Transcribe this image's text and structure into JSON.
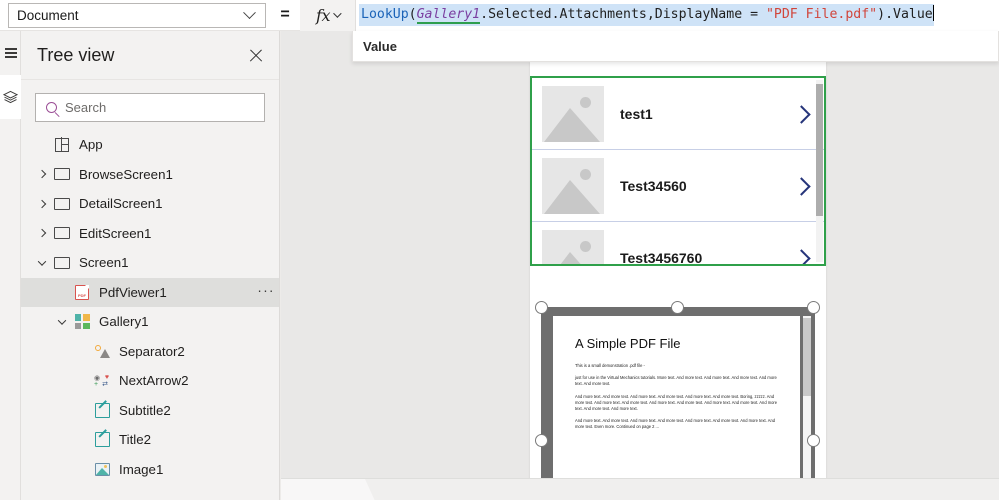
{
  "topbar": {
    "property_selector": {
      "value": "Document",
      "icon": "chevron-down-icon"
    },
    "equals_sign": "=",
    "fx_label": "fx",
    "formula": {
      "tokens": [
        {
          "text": "LookUp",
          "kind": "fn"
        },
        {
          "text": "(",
          "kind": "op"
        },
        {
          "text": "Gallery1",
          "kind": "ctrl"
        },
        {
          "text": ".Selected.Attachments,DisplayName",
          "kind": "plain"
        },
        {
          "text": " = ",
          "kind": "op"
        },
        {
          "text": "\"PDF File.pdf\"",
          "kind": "str"
        },
        {
          "text": ").Value",
          "kind": "plain"
        }
      ],
      "plain_text": "LookUp(Gallery1.Selected.Attachments,DisplayName = \"PDF File.pdf\").Value"
    },
    "intellisense": {
      "suggestion": "Value"
    }
  },
  "rail": {
    "items": [
      {
        "name": "menu",
        "icon": "hamburger-icon",
        "active": false
      },
      {
        "name": "tree-view",
        "icon": "layers-icon",
        "active": true
      }
    ]
  },
  "tree_panel": {
    "title": "Tree view",
    "close_label": "×",
    "search": {
      "placeholder": "Search",
      "value": "",
      "icon": "search-icon"
    },
    "items": [
      {
        "label": "App",
        "icon": "app-icon",
        "indent": 0,
        "chevron": "none",
        "selected": false
      },
      {
        "label": "BrowseScreen1",
        "icon": "screen-icon",
        "indent": 0,
        "chevron": "collapsed",
        "selected": false
      },
      {
        "label": "DetailScreen1",
        "icon": "screen-icon",
        "indent": 0,
        "chevron": "collapsed",
        "selected": false
      },
      {
        "label": "EditScreen1",
        "icon": "screen-icon",
        "indent": 0,
        "chevron": "collapsed",
        "selected": false
      },
      {
        "label": "Screen1",
        "icon": "screen-icon",
        "indent": 0,
        "chevron": "expanded",
        "selected": false
      },
      {
        "label": "PdfViewer1",
        "icon": "pdf-icon",
        "indent": 1,
        "chevron": "none",
        "selected": true,
        "menu": "···"
      },
      {
        "label": "Gallery1",
        "icon": "gallery-icon",
        "indent": 1,
        "chevron": "expanded",
        "selected": false
      },
      {
        "label": "Separator2",
        "icon": "separator-icon",
        "indent": 2,
        "chevron": "none",
        "selected": false
      },
      {
        "label": "NextArrow2",
        "icon": "arrow-icon",
        "indent": 2,
        "chevron": "none",
        "selected": false
      },
      {
        "label": "Subtitle2",
        "icon": "text-icon",
        "indent": 2,
        "chevron": "none",
        "selected": false
      },
      {
        "label": "Title2",
        "icon": "text-icon",
        "indent": 2,
        "chevron": "none",
        "selected": false
      },
      {
        "label": "Image1",
        "icon": "image-icon",
        "indent": 2,
        "chevron": "none",
        "selected": false
      }
    ]
  },
  "canvas": {
    "gallery": {
      "selected": true,
      "selection_color": "#2fa04a",
      "rows": [
        {
          "title": "test1",
          "arrow": "chevron-right-icon"
        },
        {
          "title": "Test34560",
          "arrow": "chevron-right-icon"
        },
        {
          "title": "Test3456760",
          "arrow": "chevron-right-icon"
        }
      ]
    },
    "pdf_viewer": {
      "selected": true,
      "document": {
        "heading": "A Simple PDF File",
        "paragraphs": [
          "This is a small demonstration .pdf file -",
          "just for use in the Virtual Mechanics tutorials. More text. And more text. And more text. And more text. And more text. And more text.",
          "And more text. And more text. And more text. And more text. And more text. And more text. Boring, zzzzz. And more text. And more text. And more text. And more text. And more text. And more text. And more text. And more text. And more text. And more text.",
          "And more text. And more text. And more text. And more text. And more text. And more text. And more text. And more text. Even more. Continued on page 2 ..."
        ]
      },
      "handles": 6
    }
  },
  "colors": {
    "selection_green": "#2fa04a",
    "formula_fn": "#1b63b8",
    "formula_control": "#7a3fa0",
    "formula_string": "#d1453b",
    "formula_highlight": "#cfe3f7",
    "search_icon": "#9b4f96",
    "pdf_icon": "#d9534f"
  }
}
